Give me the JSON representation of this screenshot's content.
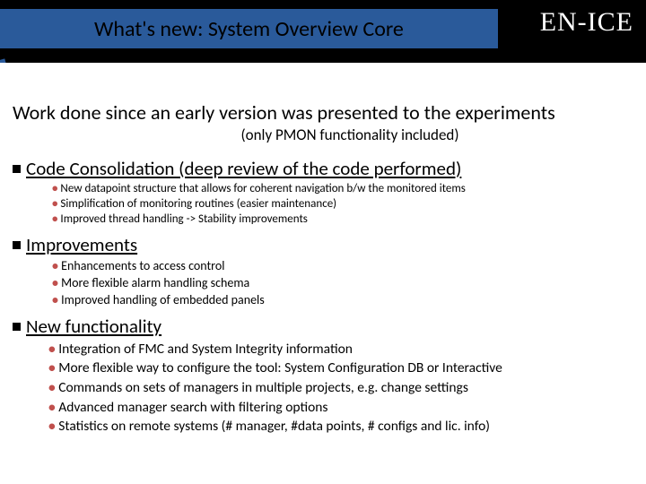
{
  "header": {
    "title": "What's new: System Overview Core",
    "brand": "EN-ICE"
  },
  "intro": {
    "line": "Work done since an early version was presented to the experiments",
    "sub": "(only PMON functionality included)"
  },
  "sections": [
    {
      "title": "Code Consolidation (deep review of the code performed)",
      "items": [
        "New datapoint structure that allows for coherent navigation b/w the monitored items",
        "Simplification of  monitoring routines (easier maintenance)",
        "Improved thread handling -> Stability improvements"
      ]
    },
    {
      "title": "Improvements",
      "items": [
        "Enhancements to access control",
        "More flexible alarm handling schema",
        "Improved handling of embedded panels"
      ]
    },
    {
      "title": "New functionality",
      "items": [
        "Integration of FMC and System Integrity information",
        "More flexible way to configure the tool: System Configuration DB or Interactive",
        "Commands on sets of managers in multiple projects, e.g. change settings",
        "Advanced manager search with filtering options",
        "Statistics on remote systems (# manager, #data points, # configs and lic. info)"
      ]
    }
  ]
}
